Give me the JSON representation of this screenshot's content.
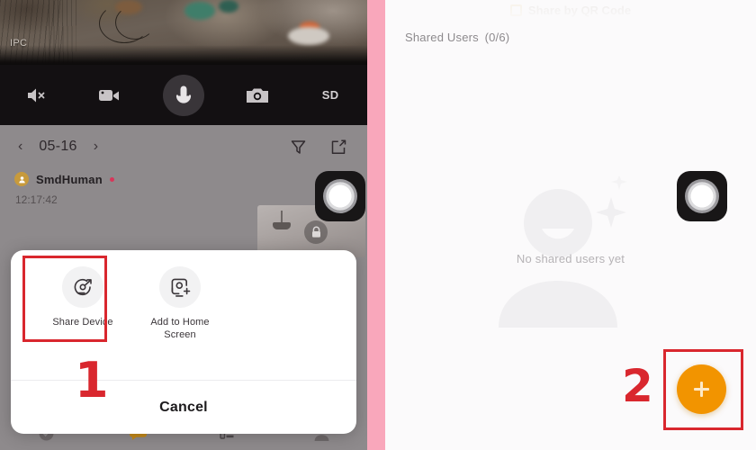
{
  "left_panel": {
    "feed": {
      "channel_label": "IPC"
    },
    "camera_toolbar": {
      "buttons": [
        {
          "name": "mute-icon",
          "label": ""
        },
        {
          "name": "record-video-icon",
          "label": ""
        },
        {
          "name": "microphone-icon",
          "label": ""
        },
        {
          "name": "snapshot-camera-icon",
          "label": ""
        }
      ],
      "quality_label": "SD"
    },
    "date_bar": {
      "prev_label": "‹",
      "date": "05-16",
      "next_label": "›",
      "filter_icon": "filter-funnel-icon",
      "edit_icon": "edit-square-icon"
    },
    "event": {
      "name": "SmdHuman",
      "time": "12:17:42",
      "unread": true
    },
    "action_sheet": {
      "actions": [
        {
          "icon": "share-device-icon",
          "label": "Share Device"
        },
        {
          "icon": "add-to-home-screen-icon",
          "label": "Add to Home Screen"
        }
      ],
      "cancel_label": "Cancel"
    },
    "tab_bar": {
      "items": [
        "home-tab-icon",
        "message-tab-icon",
        "list-tab-icon",
        "profile-tab-icon"
      ]
    }
  },
  "right_panel": {
    "header_ghost_title": "Share by QR Code",
    "shared_users_label": "Shared Users (0/6)",
    "empty_state_text": "No shared users yet",
    "fab": {
      "icon": "plus-icon",
      "label": ""
    }
  },
  "annotations": {
    "step_one": "1",
    "step_two": "2"
  },
  "colors": {
    "divider_pink": "#f9a7bb",
    "annotation_red": "#d9272e",
    "fab_orange": "#f29400",
    "toolbar_dark": "#131012",
    "page_grey": "#8e8a8c"
  }
}
